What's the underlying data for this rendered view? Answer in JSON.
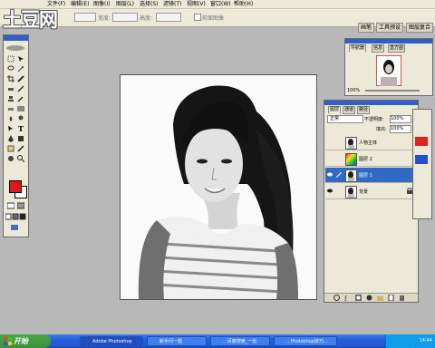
{
  "app": {
    "logo_text": "土豆网",
    "menus": [
      "文件(F)",
      "编辑(E)",
      "图像(I)",
      "图层(L)",
      "选择(S)",
      "滤镜(T)",
      "视图(V)",
      "窗口(W)",
      "帮助(H)"
    ]
  },
  "options_bar": {
    "field1_value": "",
    "width_label": "宽度:",
    "height_label": "高度:",
    "checkbox_label": "前面图像"
  },
  "palette_well": {
    "tabs": [
      "画笔",
      "工具预设",
      "图层复合"
    ]
  },
  "navigator": {
    "tabs": [
      "导航器",
      "信息",
      "直方图"
    ],
    "zoom": "100%"
  },
  "layers_panel": {
    "tabs": [
      "图层",
      "通道",
      "路径"
    ],
    "blend_mode": "正常",
    "opacity_label": "不透明度:",
    "opacity_value": "100%",
    "fill_label": "填充:",
    "fill_value": "100%",
    "layers": [
      {
        "name": "人物主体",
        "selected": false,
        "visible": false
      },
      {
        "name": "图层 2",
        "selected": false,
        "visible": false
      },
      {
        "name": "图层 1",
        "selected": true,
        "visible": true
      },
      {
        "name": "背景",
        "selected": false,
        "visible": true
      }
    ]
  },
  "taskbar": {
    "start_label": "开始",
    "tasks": [
      "Adobe Photoshop",
      "新手问一题",
      ".. 百度搜索_一张",
      ".. Photoshop技巧..."
    ],
    "clock": "14:44"
  },
  "colors": {
    "foreground": "#e01818",
    "background": "#ffffff",
    "workspace": "#b8b8b8"
  }
}
